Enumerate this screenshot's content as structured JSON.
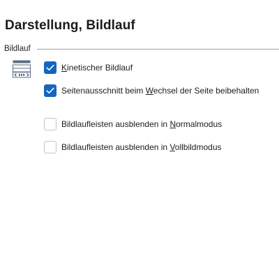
{
  "page": {
    "title": "Darstellung, Bildlauf"
  },
  "group": {
    "label": "Bildlauf",
    "icon": "scroll-settings-icon"
  },
  "options": [
    {
      "pre": "",
      "mnemonic": "K",
      "post": "inetischer Bildlauf",
      "checked": true
    },
    {
      "pre": "Seitenausschnitt beim ",
      "mnemonic": "W",
      "post": "echsel der Seite beibehalten",
      "checked": true
    },
    {
      "pre": "Bildlaufleisten ausblenden in ",
      "mnemonic": "N",
      "post": "ormalmodus",
      "checked": false
    },
    {
      "pre": "Bildlaufleisten ausblenden in ",
      "mnemonic": "V",
      "post": "ollbildmodus",
      "checked": false
    }
  ],
  "colors": {
    "accent": "#1565c0",
    "checkbox_border": "#c4c4c4",
    "divider": "#a0a0a0"
  }
}
